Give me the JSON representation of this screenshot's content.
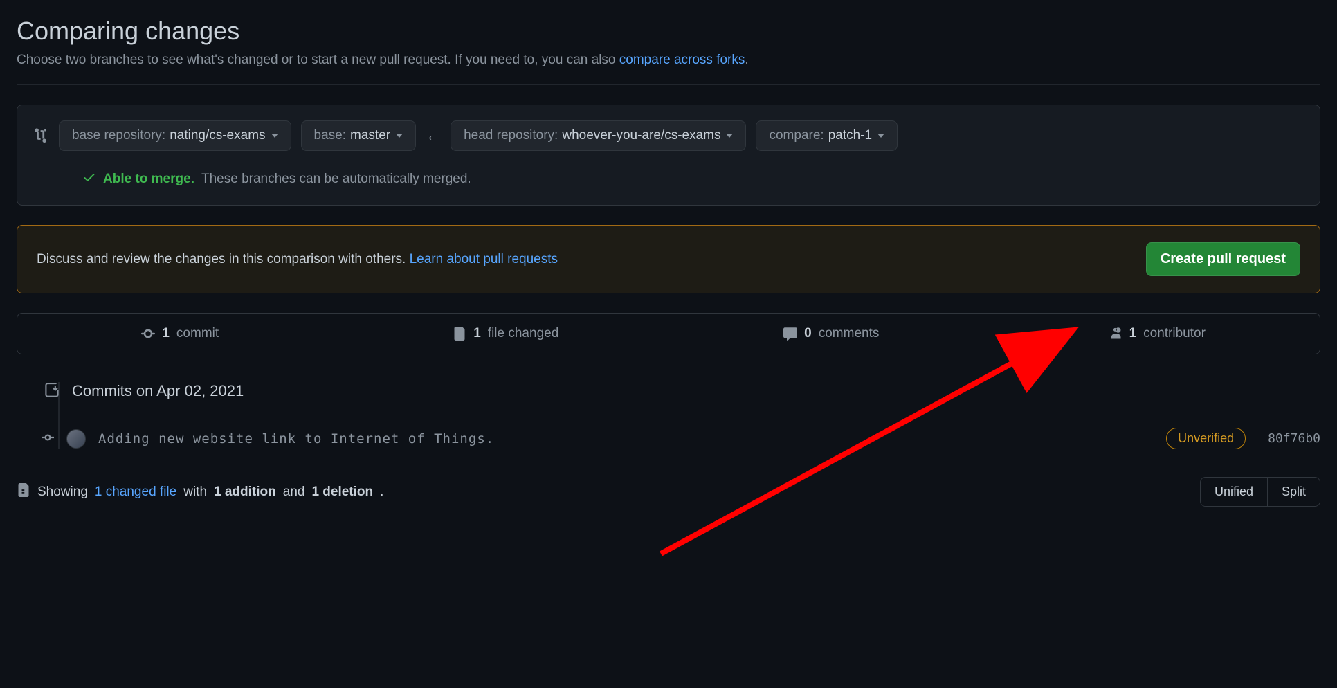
{
  "header": {
    "title": "Comparing changes",
    "subtitle_prefix": "Choose two branches to see what's changed or to start a new pull request. If you need to, you can also ",
    "compare_forks_link": "compare across forks",
    "subtitle_suffix": "."
  },
  "compare": {
    "base_repo_label": "base repository:",
    "base_repo_value": "nating/cs-exams",
    "base_label": "base:",
    "base_value": "master",
    "head_repo_label": "head repository:",
    "head_repo_value": "whoever-you-are/cs-exams",
    "compare_label": "compare:",
    "compare_value": "patch-1",
    "merge_able": "Able to merge.",
    "merge_msg": "These branches can be automatically merged."
  },
  "discuss": {
    "text": "Discuss and review the changes in this comparison with others. ",
    "link": "Learn about pull requests",
    "button": "Create pull request"
  },
  "stats": {
    "commits_n": "1",
    "commits_label": "commit",
    "files_n": "1",
    "files_label": "file changed",
    "comments_n": "0",
    "comments_label": "comments",
    "contributors_n": "1",
    "contributors_label": "contributor"
  },
  "commits": {
    "date_label": "Commits on Apr 02, 2021",
    "rows": [
      {
        "message": "Adding new website link to Internet of Things.",
        "badge": "Unverified",
        "sha": "80f76b0"
      }
    ]
  },
  "footer": {
    "showing": "Showing ",
    "changed_file_link": "1 changed file",
    "with": " with ",
    "addition": "1 addition",
    "and": " and ",
    "deletion": "1 deletion",
    "period": ".",
    "unified": "Unified",
    "split": "Split"
  }
}
